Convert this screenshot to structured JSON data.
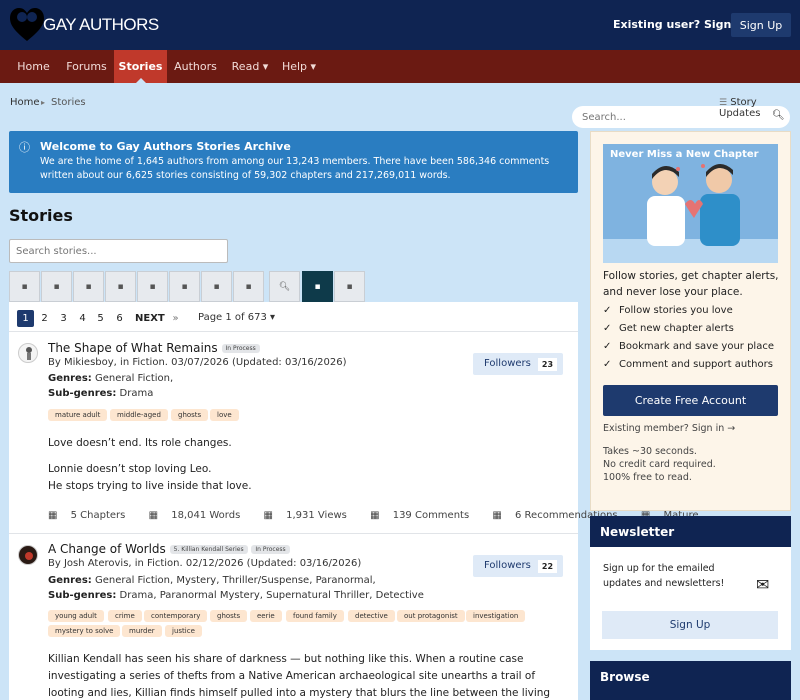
{
  "header": {
    "logo_text": "GAY AUTHORS",
    "existing_user": "Existing user? Sign In",
    "sign_up": "Sign Up"
  },
  "nav": {
    "items": [
      "Home",
      "Forums",
      "Stories",
      "Authors",
      "Read ▾",
      "Help ▾"
    ],
    "active": "Stories",
    "search_placeholder": "Search..."
  },
  "breadcrumb": {
    "home": "Home",
    "sep": "▸",
    "current": "Stories",
    "story_updates": "Story Updates"
  },
  "welcome": {
    "icon": "info-icon",
    "title": "Welcome to Gay Authors Stories Archive",
    "body": "We are the home of 1,645 authors from among our 13,243 members. There have been 586,346 comments written about our 6,625 stories consisting of 59,302 chapters and 217,269,011 words."
  },
  "page_title": "Stories",
  "story_search_placeholder": "Search stories...",
  "filter_icons": [
    "filter-icon-1",
    "filter-icon-2",
    "filter-icon-3",
    "filter-icon-4",
    "filter-icon-5",
    "filter-icon-6",
    "filter-icon-7",
    "filter-icon-8",
    "search-icon",
    "grid-icon",
    "list-icon"
  ],
  "pagination": {
    "pages": [
      "1",
      "2",
      "3",
      "4",
      "5",
      "6"
    ],
    "active": "1",
    "next": "NEXT",
    "next_icon": "»",
    "page_of": "Page 1 of 673 ▾"
  },
  "stories": [
    {
      "title": "The Shape of What Remains",
      "badges": [
        "In Process"
      ],
      "byline": "By Mikiesboy, in Fiction. 03/07/2026 (Updated: 03/16/2026)",
      "genres_label": "Genres:",
      "genres": "General Fiction,",
      "subgenres_label": "Sub-genres:",
      "subgenres": "Drama",
      "tags": [
        "mature adult",
        "middle-aged",
        "ghosts",
        "love"
      ],
      "followers_label": "Followers",
      "followers_count": "23",
      "desc": [
        "Love doesn’t end. Its role changes.",
        "Lonnie doesn’t stop loving Leo.",
        "He stops trying to live inside that love."
      ],
      "meta": [
        "5 Chapters",
        "18,041 Words",
        "1,931 Views",
        "139 Comments",
        "6 Recommendations",
        "Mature"
      ]
    },
    {
      "title": "A Change of Worlds",
      "badges": [
        "5. Killian Kendall Series",
        "In Process"
      ],
      "byline": "By Josh Aterovis, in Fiction. 02/12/2026 (Updated: 03/16/2026)",
      "genres_label": "Genres:",
      "genres": "General Fiction, Mystery, Thriller/Suspense, Paranormal,",
      "subgenres_label": "Sub-genres:",
      "subgenres": "Drama, Paranormal Mystery, Supernatural Thriller, Detective",
      "tags": [
        "young adult",
        "crime",
        "contemporary",
        "ghosts",
        "eerie",
        "found family",
        "detective",
        "out protagonist",
        "investigation",
        "mystery to solve",
        "murder",
        "justice"
      ],
      "followers_label": "Followers",
      "followers_count": "22",
      "desc": [
        "Killian Kendall has seen his share of darkness — but nothing like this. When a routine case investigating a series of thefts from a Native American archaeological site unearths a trail of looting and lies, Killian finds himself pulled into a mystery that blurs the line between the living and the dead. A simple case of missing artifacts"
      ]
    }
  ],
  "sidebar": {
    "banner_title": "Never Miss a New Chapter",
    "intro": "Follow stories, get chapter alerts, and never lose your place.",
    "checks": [
      "Follow stories you love",
      "Get new chapter alerts",
      "Bookmark and save your place",
      "Comment and support authors"
    ],
    "check_mark": "✓",
    "cta": "Create Free Account",
    "existing": "Existing member? Sign in →",
    "fine": [
      "Takes ~30 seconds.",
      "No credit card required.",
      "100% free to read."
    ]
  },
  "newsletter": {
    "title": "Newsletter",
    "text": "Sign up for the emailed updates and newsletters!",
    "icon": "envelope-icon",
    "button": "Sign Up"
  },
  "browse": {
    "title": "Browse"
  }
}
